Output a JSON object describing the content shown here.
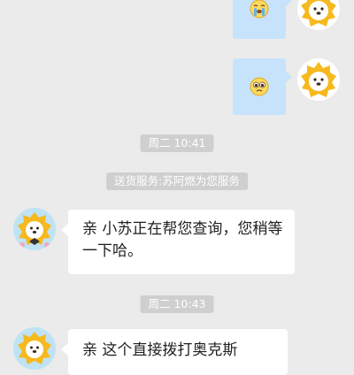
{
  "messages": [
    {
      "type": "outgoing-emoji",
      "emoji_icon": "crying-face-emoji",
      "avatar_icon": "lion-mascot-icon"
    },
    {
      "type": "outgoing-emoji",
      "emoji_icon": "pleading-face-emoji",
      "avatar_icon": "lion-mascot-icon"
    },
    {
      "type": "time",
      "text": "周二 10:41"
    },
    {
      "type": "system",
      "text": "送货服务:苏阿燃为您服务"
    },
    {
      "type": "incoming-text",
      "lines": [
        "亲  小苏正在帮您查询，您稍等",
        "一下哈。"
      ],
      "avatar_icon": "lion-mascot-avatar-icon"
    },
    {
      "type": "time",
      "text": "周二 10:43"
    },
    {
      "type": "incoming-text",
      "lines": [
        "亲  这个直接拨打奥克斯"
      ],
      "avatar_icon": "lion-mascot-avatar-icon"
    }
  ],
  "colors": {
    "background": "#ebebeb",
    "outgoing_bubble": "#c6e3fb",
    "incoming_bubble": "#ffffff",
    "pill_background": "#cfcfcf",
    "mascot_yellow": "#f6b91e"
  }
}
